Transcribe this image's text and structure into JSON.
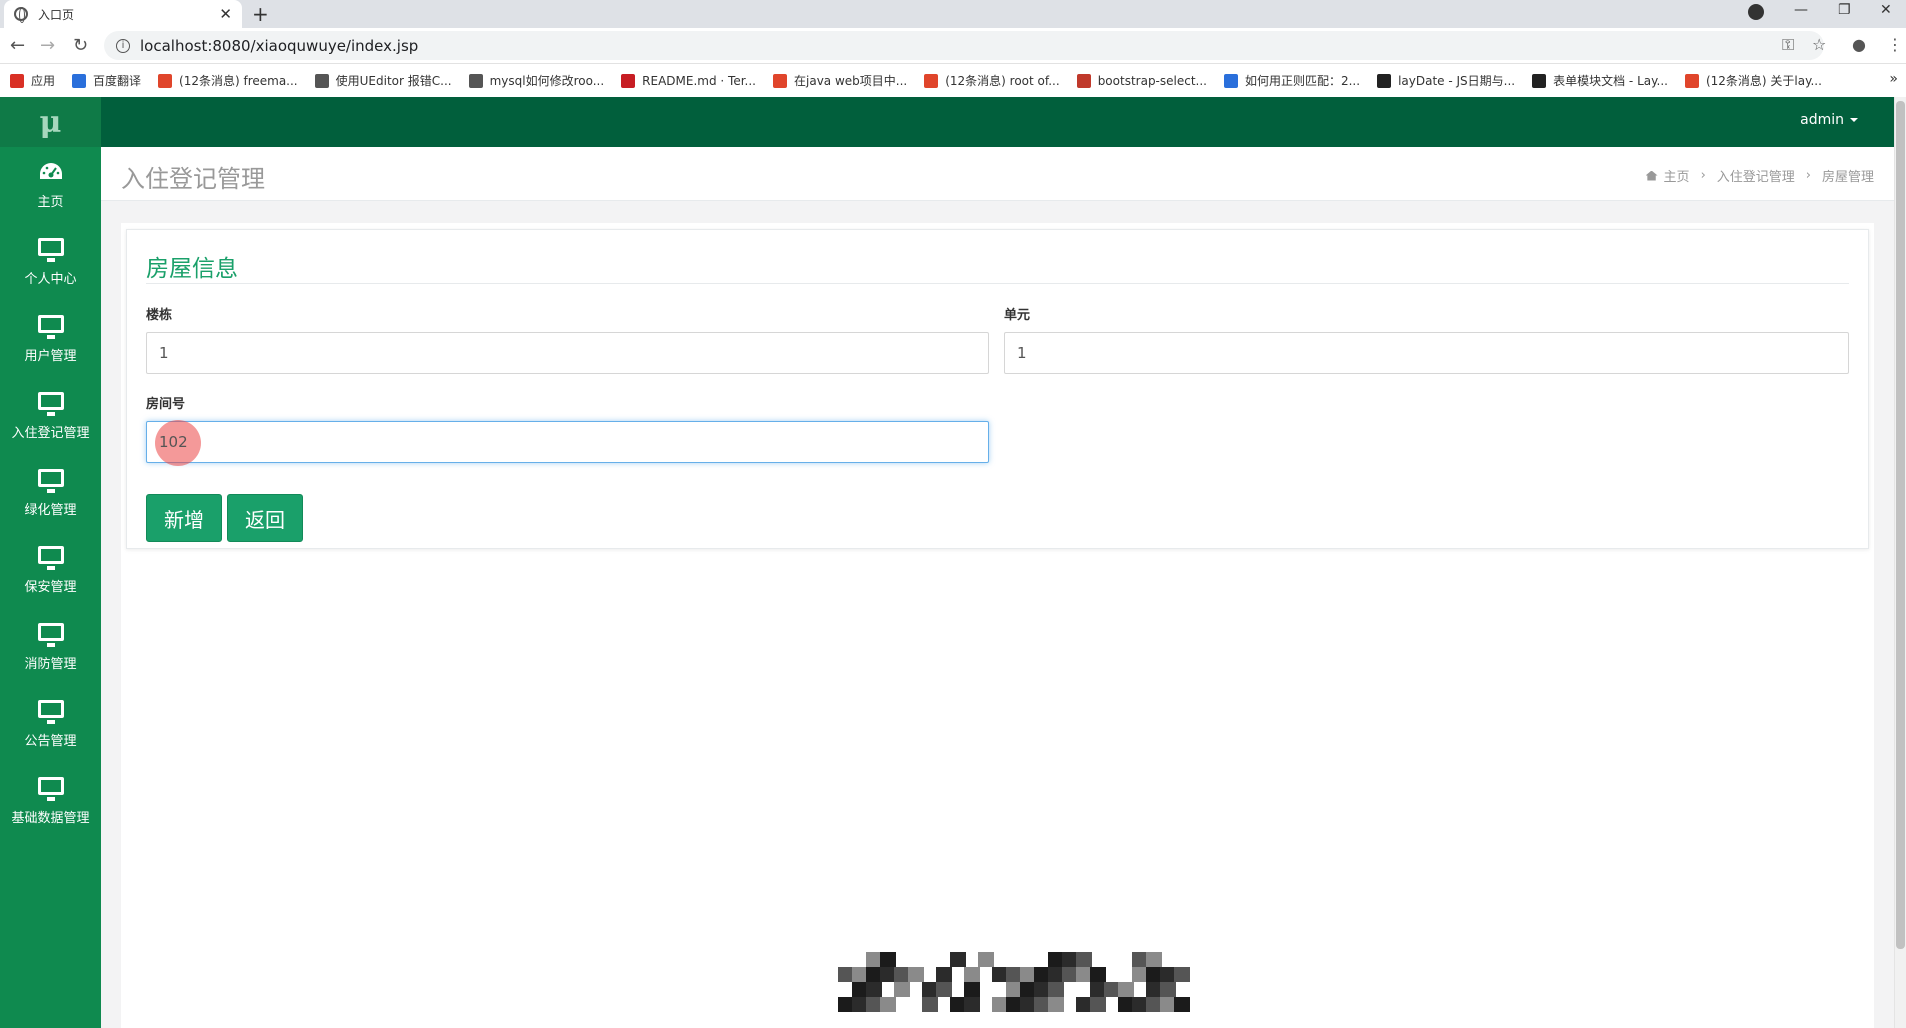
{
  "browser": {
    "tab_title": "入口页",
    "url": "localhost:8080/xiaoquwuye/index.jsp",
    "bookmarks": [
      {
        "label": "应用",
        "color": "#d93025"
      },
      {
        "label": "百度翻译",
        "color": "#2a6fdb"
      },
      {
        "label": "(12条消息) freema...",
        "color": "#e0452b"
      },
      {
        "label": "使用UEditor 报错C...",
        "color": "#555555"
      },
      {
        "label": "mysql如何修改roo...",
        "color": "#555555"
      },
      {
        "label": "README.md · Ter...",
        "color": "#c71d23"
      },
      {
        "label": "在java web项目中...",
        "color": "#e0452b"
      },
      {
        "label": "(12条消息) root of...",
        "color": "#e0452b"
      },
      {
        "label": "bootstrap-select...",
        "color": "#c0392b"
      },
      {
        "label": "如何用正则匹配：2...",
        "color": "#2a6fdb"
      },
      {
        "label": "layDate - JS日期与...",
        "color": "#222222"
      },
      {
        "label": "表单模块文档 - Lay...",
        "color": "#222222"
      },
      {
        "label": "(12条消息) 关于lay...",
        "color": "#e0452b"
      }
    ]
  },
  "sidebar": {
    "logo": "μ",
    "items": [
      {
        "label": "主页",
        "icon": "dashboard-icon"
      },
      {
        "label": "个人中心",
        "icon": "monitor-icon"
      },
      {
        "label": "用户管理",
        "icon": "monitor-icon"
      },
      {
        "label": "入住登记管理",
        "icon": "monitor-icon"
      },
      {
        "label": "绿化管理",
        "icon": "monitor-icon"
      },
      {
        "label": "保安管理",
        "icon": "monitor-icon"
      },
      {
        "label": "消防管理",
        "icon": "monitor-icon"
      },
      {
        "label": "公告管理",
        "icon": "monitor-icon"
      },
      {
        "label": "基础数据管理",
        "icon": "monitor-icon"
      }
    ]
  },
  "topbar": {
    "user": "admin"
  },
  "header": {
    "title": "入住登记管理",
    "breadcrumb": [
      "主页",
      "入住登记管理",
      "房屋管理"
    ]
  },
  "form": {
    "title": "房屋信息",
    "building_label": "楼栋",
    "building_value": "1",
    "unit_label": "单元",
    "unit_value": "1",
    "room_label": "房间号",
    "room_value": "102",
    "add_button": "新增",
    "back_button": "返回"
  },
  "colors": {
    "sidebar": "#0f8a4f",
    "topbar": "#015f3c",
    "accent": "#1aa06a"
  }
}
